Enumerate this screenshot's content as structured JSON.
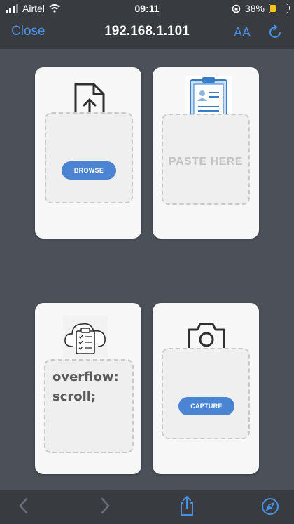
{
  "status": {
    "carrier": "Airtel",
    "time": "09:11",
    "battery": "38%",
    "battery_level": 0.38
  },
  "nav": {
    "close": "Close",
    "url": "192.168.1.101",
    "text_size": "AA"
  },
  "cards": {
    "upload": {
      "button": "BROWSE"
    },
    "clipboard": {
      "paste_label": "PASTE HERE"
    },
    "cloud": {
      "lines": [
        "overflow:",
        "scroll;"
      ]
    },
    "camera": {
      "button": "CAPTURE"
    }
  },
  "icons": {
    "back": "chevron-left-icon",
    "forward": "chevron-right-icon",
    "share": "share-icon",
    "safari": "compass-icon"
  },
  "colors": {
    "accent": "#4a90e2",
    "button": "#4a84d2",
    "battery": "#f5c518"
  }
}
